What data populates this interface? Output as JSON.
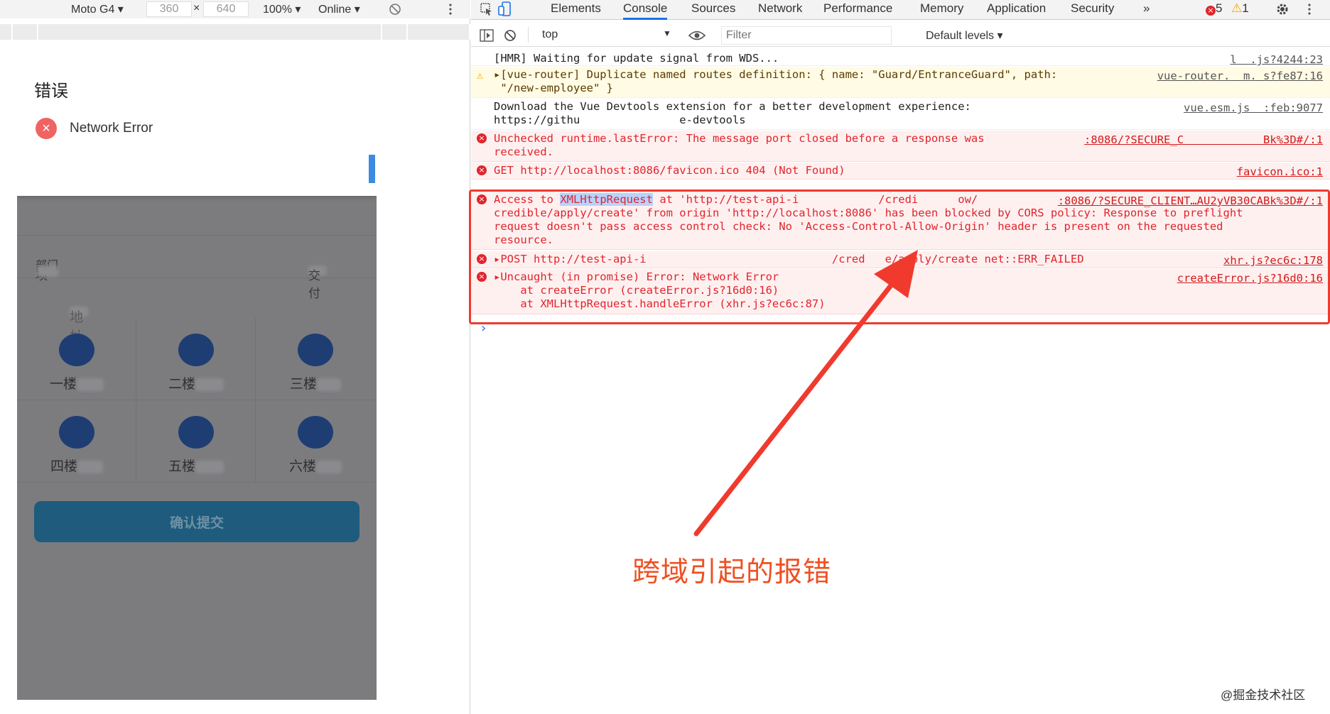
{
  "device_toolbar": {
    "device": "Moto G4 ▾",
    "width": "360",
    "times": "×",
    "height": "640",
    "zoom": "100% ▾",
    "network": "Online ▾"
  },
  "mobile": {
    "dialog": {
      "title": "错误",
      "message": "Network Error"
    },
    "rows": [
      {
        "label": "部门",
        "value": ""
      },
      {
        "label": "项",
        "value": "交付"
      }
    ],
    "address_label": "地址",
    "floors": [
      "一楼",
      "二楼",
      "三楼",
      "四楼",
      "五楼",
      "六楼"
    ],
    "submit_label": "确认提交"
  },
  "devtools": {
    "tabs": [
      "Elements",
      "Console",
      "Sources",
      "Network",
      "Performance",
      "Memory",
      "Application",
      "Security",
      "»"
    ],
    "error_count": "5",
    "warning_count": "1",
    "context": "top",
    "filter_placeholder": "Filter",
    "levels": "Default levels ▾",
    "messages": [
      {
        "text": "[HMR] Waiting for update signal from WDS...",
        "source": "l  .js?4244:23"
      },
      {
        "text": "▸[vue-router] Duplicate named routes definition: { name: \"Guard/EntranceGuard\", path:\n \"/new-employee\" }",
        "source": "vue-router.  m. s?fe87:16"
      },
      {
        "text": "Download the Vue Devtools extension for a better development experience:\nhttps://githu               e-devtools",
        "source": "vue.esm.js  :feb:9077"
      },
      {
        "text": "Unchecked runtime.lastError: The message port closed before a response was\nreceived.",
        "source": ":8086/?SECURE_C            Bk%3D#/:1"
      },
      {
        "text": "GET http://localhost:8086/favicon.ico 404 (Not Found)",
        "source": "favicon.ico:1"
      },
      {
        "text_pre": "Access to ",
        "text_hl": "XMLHttpRequest",
        "text_post": " at 'http://test-api-i            /credi      ow/\ncredible/apply/create' from origin 'http://localhost:8086' has been blocked by CORS policy: Response to preflight\nrequest doesn't pass access control check: No 'Access-Control-Allow-Origin' header is present on the requested\nresource.",
        "source": ":8086/?SECURE_CLIENT…AU2yVB30CABk%3D#/:1"
      },
      {
        "text": "▸POST http://test-api-i                            /cred   e/apply/create net::ERR_FAILED",
        "source": "xhr.js?ec6c:178"
      },
      {
        "text": "▸Uncaught (in promise) Error: Network Error\n    at createError (createError.js?16d0:16)\n    at XMLHttpRequest.handleError (xhr.js?ec6c:87)",
        "source": "createError.js?16d0:16"
      }
    ],
    "prompt": "›"
  },
  "annotation": {
    "caption": "跨域引起的报错",
    "arrow_color": "#f03a2e"
  },
  "watermark": "@掘金技术社区"
}
